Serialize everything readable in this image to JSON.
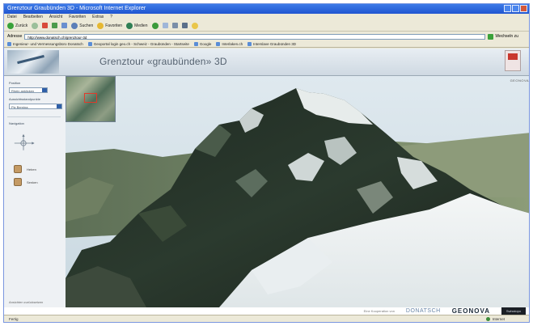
{
  "window": {
    "title": "Grenztour Graubünden 3D - Microsoft Internet Explorer"
  },
  "menu": [
    "Datei",
    "Bearbeiten",
    "Ansicht",
    "Favoriten",
    "Extras",
    "?"
  ],
  "toolbar": {
    "back_label": "Zurück",
    "search_label": "Suchen",
    "favorites_label": "Favoriten",
    "media_label": "Medien"
  },
  "address": {
    "label": "Adresse",
    "url": "http://www.donatsch.ch/grenztour-3d",
    "go_label": "Wechseln zu"
  },
  "links": [
    "Ingenieur- und Vermessungsbüro Donatsch",
    "Geoportal login geo.ch - Schweiz - Graubünden - Startseite",
    "Google",
    "Interlaken.ch",
    "Interslave Graubünden 3D"
  ],
  "site": {
    "title": "Grenztour «graubünden» 3D"
  },
  "sidebar": {
    "section1": "Position",
    "select1": "Rhein anklicken",
    "section2": "Aussichtsstandpunkte",
    "select2": "Piz Bernina",
    "section3": "Navigation",
    "btn1_label": "Heben",
    "btn2_label": "Senken",
    "footer": "Ansichten zurücksetzen"
  },
  "scene": {
    "label": "GEONOVA"
  },
  "partners": {
    "caption": "Eine Kooperation von",
    "donatsch": "DONATSCH",
    "geonova": "GEONOVA",
    "dark": "Swisstopo"
  },
  "status": {
    "left": "Fertig",
    "zone": "Internet"
  },
  "colors": {
    "title_gradient_top": "#3d7be8",
    "title_gradient_bottom": "#1f55d0",
    "sky": "#d7e3eb"
  }
}
